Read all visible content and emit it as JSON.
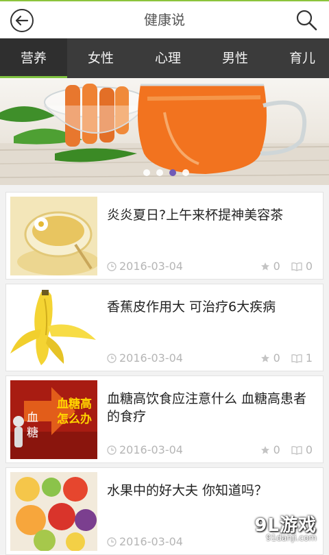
{
  "header": {
    "title": "健康说"
  },
  "tabs": [
    {
      "label": "营养",
      "active": true
    },
    {
      "label": "女性",
      "active": false
    },
    {
      "label": "心理",
      "active": false
    },
    {
      "label": "男性",
      "active": false
    },
    {
      "label": "育儿",
      "active": false
    }
  ],
  "banner": {
    "dots_total": 4,
    "dots_active_index": 2
  },
  "articles": [
    {
      "title": "炎炎夏日?上午来杯提神美容茶",
      "date": "2016-03-04",
      "favorites": "0",
      "reads": "0",
      "thumb": "tea-cup"
    },
    {
      "title": "香蕉皮作用大 可治疗6大疾病",
      "date": "2016-03-04",
      "favorites": "0",
      "reads": "1",
      "thumb": "banana-peel"
    },
    {
      "title": "血糖高饮食应注意什么 血糖高患者的食疗",
      "date": "2016-03-04",
      "favorites": "0",
      "reads": "0",
      "thumb": "blood-sugar",
      "thumb_text_1": "血糖高",
      "thumb_text_2": "怎么办",
      "thumb_text_3": "血",
      "thumb_text_4": "糖"
    },
    {
      "title": "水果中的好大夫 你知道吗？",
      "date": "2016-03-04",
      "favorites": "",
      "reads": "",
      "thumb": "fruits"
    }
  ],
  "watermark": {
    "logo": "9L游戏",
    "url": "91danji.com"
  },
  "colors": {
    "accent": "#7ec23f",
    "tab_bar": "#3b3b3b",
    "text": "#222222",
    "meta": "#b5b5b5"
  }
}
